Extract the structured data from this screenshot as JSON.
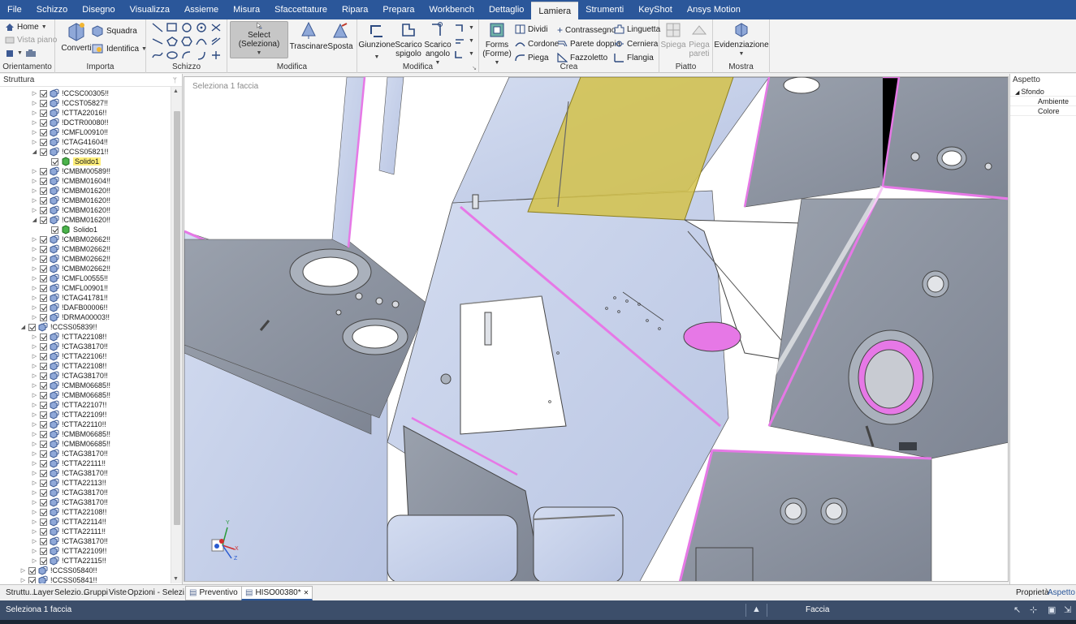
{
  "menu": {
    "tabs": [
      "File",
      "Schizzo",
      "Disegno",
      "Visualizza",
      "Assieme",
      "Misura",
      "Sfaccettature",
      "Ripara",
      "Prepara",
      "Workbench",
      "Dettaglio",
      "Lamiera",
      "Strumenti",
      "KeyShot",
      "Ansys Motion"
    ],
    "active": "Lamiera"
  },
  "ribbon": {
    "orientamento": {
      "title": "Orientamento",
      "home": "Home",
      "vista_piano": "Vista piano"
    },
    "importa": {
      "title": "Importa",
      "converti": "Converti",
      "squadra": "Squadra",
      "identifica": "Identifica"
    },
    "schizzo": {
      "title": "Schizzo"
    },
    "modifica": {
      "title": "Modifica",
      "select": "Select (Seleziona)",
      "trascinare": "Trascinare",
      "sposta": "Sposta"
    },
    "modifica2": {
      "title": "Modifica",
      "giunzione": "Giunzione",
      "scarico_spigolo": "Scarico spigolo",
      "scarico_angolo": "Scarico angolo"
    },
    "crea": {
      "title": "Crea",
      "forms": "Forms (Forme)",
      "dividi": "Dividi",
      "cordone": "Cordone",
      "piega": "Piega",
      "contrassegno": "Contrassegno",
      "parete_doppia": "Parete doppia",
      "fazzoletto": "Fazzoletto",
      "linguetta": "Linguetta",
      "cerniera": "Cerniera",
      "flangia": "Flangia"
    },
    "piatto": {
      "title": "Piatto",
      "spiega": "Spiega",
      "piega_pareti": "Piega pareti"
    },
    "mostra": {
      "title": "Mostra",
      "evidenziazione": "Evidenziazione"
    }
  },
  "structure": {
    "title": "Struttura",
    "tree": [
      {
        "label": "!CCSC00305!!",
        "level": 1,
        "expanded": false
      },
      {
        "label": "!CCST05827!!",
        "level": 1,
        "expanded": false
      },
      {
        "label": "!CTTA22016!!",
        "level": 1,
        "expanded": false
      },
      {
        "label": "!DCTR00080!!",
        "level": 1,
        "expanded": false
      },
      {
        "label": "!CMFL00910!!",
        "level": 1,
        "expanded": false
      },
      {
        "label": "!CTAG41604!!",
        "level": 1,
        "expanded": false
      },
      {
        "label": "!CCSS05821!!",
        "level": 1,
        "expanded": true
      },
      {
        "label": "Solido1",
        "level": 2,
        "solid": true,
        "highlight": true
      },
      {
        "label": "!CMBM00589!!",
        "level": 1,
        "expanded": false
      },
      {
        "label": "!CMBM01604!!",
        "level": 1,
        "expanded": false
      },
      {
        "label": "!CMBM01620!!",
        "level": 1,
        "expanded": false
      },
      {
        "label": "!CMBM01620!!",
        "level": 1,
        "expanded": false
      },
      {
        "label": "!CMBM01620!!",
        "level": 1,
        "expanded": false
      },
      {
        "label": "!CMBM01620!!",
        "level": 1,
        "expanded": true
      },
      {
        "label": "Solido1",
        "level": 2,
        "solid": true,
        "highlight": false
      },
      {
        "label": "!CMBM02662!!",
        "level": 1,
        "expanded": false
      },
      {
        "label": "!CMBM02662!!",
        "level": 1,
        "expanded": false
      },
      {
        "label": "!CMBM02662!!",
        "level": 1,
        "expanded": false
      },
      {
        "label": "!CMBM02662!!",
        "level": 1,
        "expanded": false
      },
      {
        "label": "!CMFL00555!!",
        "level": 1,
        "expanded": false
      },
      {
        "label": "!CMFL00901!!",
        "level": 1,
        "expanded": false
      },
      {
        "label": "!CTAG41781!!",
        "level": 1,
        "expanded": false
      },
      {
        "label": "!DAFB00006!!",
        "level": 1,
        "expanded": false
      },
      {
        "label": "!DRMA00003!!",
        "level": 1,
        "expanded": false
      },
      {
        "label": "!CCSS05839!!",
        "level": 0,
        "expanded": true
      },
      {
        "label": "!CTTA22108!!",
        "level": 1,
        "expanded": false
      },
      {
        "label": "!CTAG38170!!",
        "level": 1,
        "expanded": false
      },
      {
        "label": "!CTTA22106!!",
        "level": 1,
        "expanded": false
      },
      {
        "label": "!CTTA22108!!",
        "level": 1,
        "expanded": false
      },
      {
        "label": "!CTAG38170!!",
        "level": 1,
        "expanded": false
      },
      {
        "label": "!CMBM06685!!",
        "level": 1,
        "expanded": false
      },
      {
        "label": "!CMBM06685!!",
        "level": 1,
        "expanded": false
      },
      {
        "label": "!CTTA22107!!",
        "level": 1,
        "expanded": false
      },
      {
        "label": "!CTTA22109!!",
        "level": 1,
        "expanded": false
      },
      {
        "label": "!CTTA22110!!",
        "level": 1,
        "expanded": false
      },
      {
        "label": "!CMBM06685!!",
        "level": 1,
        "expanded": false
      },
      {
        "label": "!CMBM06685!!",
        "level": 1,
        "expanded": false
      },
      {
        "label": "!CTAG38170!!",
        "level": 1,
        "expanded": false
      },
      {
        "label": "!CTTA22111!!",
        "level": 1,
        "expanded": false
      },
      {
        "label": "!CTAG38170!!",
        "level": 1,
        "expanded": false
      },
      {
        "label": "!CTTA22113!!",
        "level": 1,
        "expanded": false
      },
      {
        "label": "!CTAG38170!!",
        "level": 1,
        "expanded": false
      },
      {
        "label": "!CTAG38170!!",
        "level": 1,
        "expanded": false
      },
      {
        "label": "!CTTA22108!!",
        "level": 1,
        "expanded": false
      },
      {
        "label": "!CTTA22114!!",
        "level": 1,
        "expanded": false
      },
      {
        "label": "!CTTA22111!!",
        "level": 1,
        "expanded": false
      },
      {
        "label": "!CTAG38170!!",
        "level": 1,
        "expanded": false
      },
      {
        "label": "!CTTA22109!!",
        "level": 1,
        "expanded": false
      },
      {
        "label": "!CTTA22115!!",
        "level": 1,
        "expanded": false
      },
      {
        "label": "!CCSS05840!!",
        "level": 0,
        "expanded": false
      },
      {
        "label": "!CCSS05841!!",
        "level": 0,
        "expanded": false
      }
    ]
  },
  "viewport": {
    "hint": "Seleziona 1 faccia",
    "axes": {
      "x": "X",
      "y": "Y",
      "z": "Z"
    }
  },
  "aspect_panel": {
    "title": "Aspetto",
    "rows": [
      {
        "label": "Sfondo",
        "indent": 1,
        "expander": true
      },
      {
        "label": "Ambiente",
        "indent": 2,
        "expander": false
      },
      {
        "label": "Colore",
        "indent": 2,
        "expander": false
      }
    ]
  },
  "bottom": {
    "left_tabs": [
      "Struttu...",
      "Layer",
      "Selezio...",
      "Gruppi",
      "Viste",
      "Opzioni - Selezi..."
    ],
    "doc_tabs": [
      {
        "label": "Preventivo",
        "active": false,
        "closable": false
      },
      {
        "label": "HISO00380*",
        "active": true,
        "closable": true
      }
    ],
    "right_tabs": [
      "Proprietà",
      "Aspetto"
    ]
  },
  "status": {
    "message": "Seleziona 1 faccia",
    "mode": "Faccia"
  },
  "colors": {
    "menubar": "#2b579a",
    "model_face": "#c9d4ec",
    "model_side": "#8c939f",
    "highlight_edge": "#e678e6",
    "selected_face": "#d4c24a",
    "statusbar": "#3c4e6a"
  }
}
